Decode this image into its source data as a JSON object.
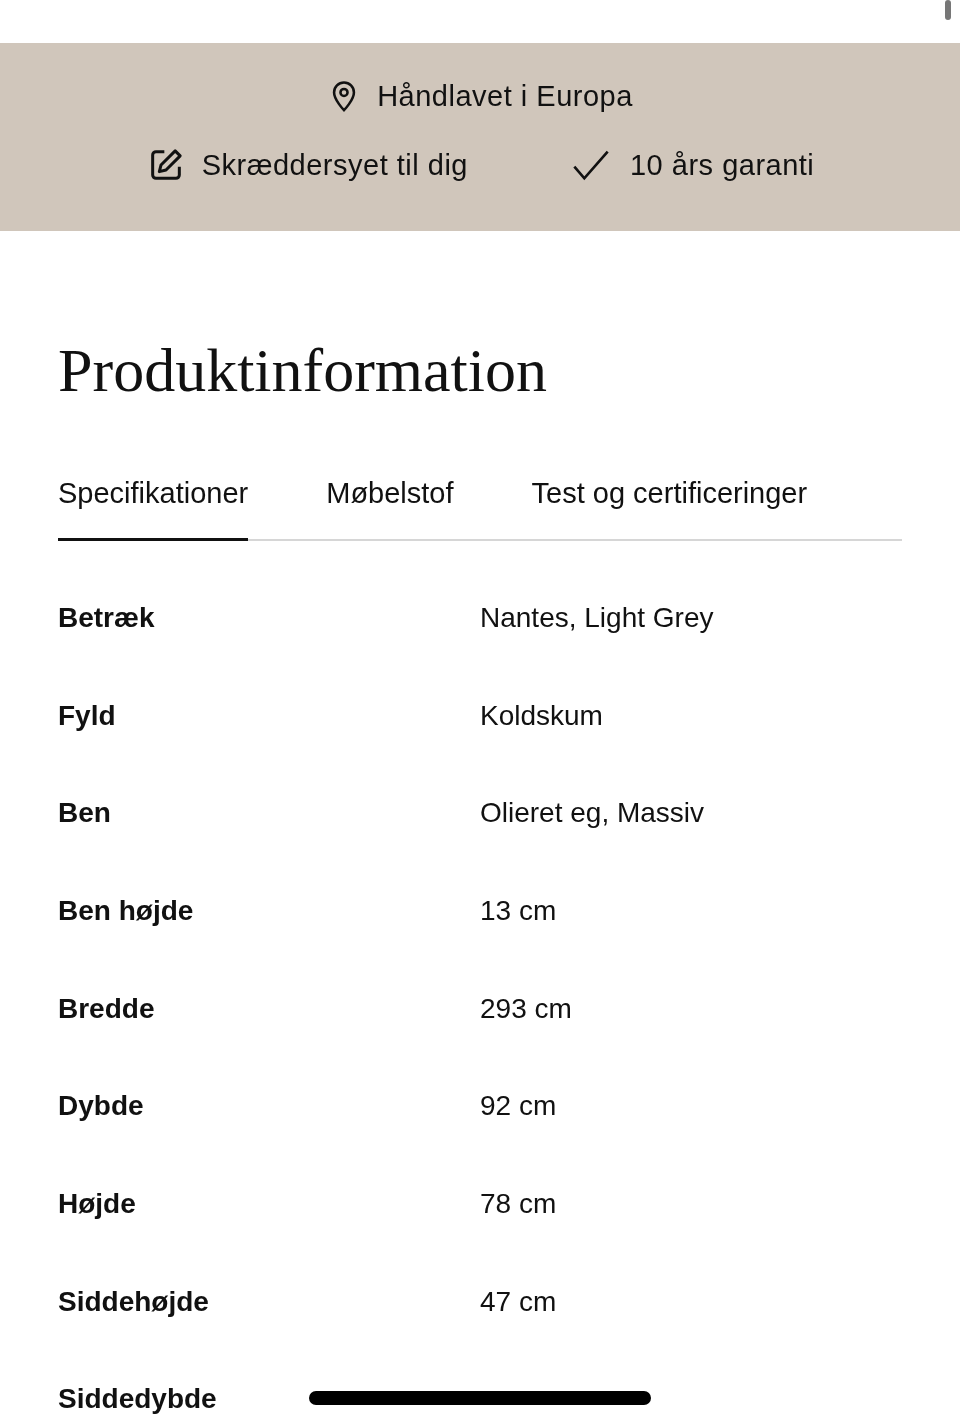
{
  "features_top": [
    {
      "kind": "location",
      "label": "Håndlavet i Europa"
    }
  ],
  "features_bottom": [
    {
      "kind": "edit",
      "label": "Skræddersyet til dig"
    },
    {
      "kind": "check",
      "label": "10 års garanti"
    }
  ],
  "section_title": "Produktinformation",
  "tabs": [
    {
      "label": "Specifikationer",
      "selected": true
    },
    {
      "label": "Møbelstof",
      "selected": false
    },
    {
      "label": "Test og certificeringer",
      "selected": false
    }
  ],
  "specs": [
    {
      "name": "Betræk",
      "value": "Nantes, Light Grey"
    },
    {
      "name": "Fyld",
      "value": "Koldskum"
    },
    {
      "name": "Ben",
      "value": "Olieret eg, Massiv"
    },
    {
      "name": "Ben højde",
      "value": "13 cm"
    },
    {
      "name": "Bredde",
      "value": "293 cm"
    },
    {
      "name": "Dybde",
      "value": "92 cm"
    },
    {
      "name": "Højde",
      "value": "78 cm"
    },
    {
      "name": "Siddehøjde",
      "value": "47 cm"
    },
    {
      "name": "Siddedybde"
    }
  ]
}
